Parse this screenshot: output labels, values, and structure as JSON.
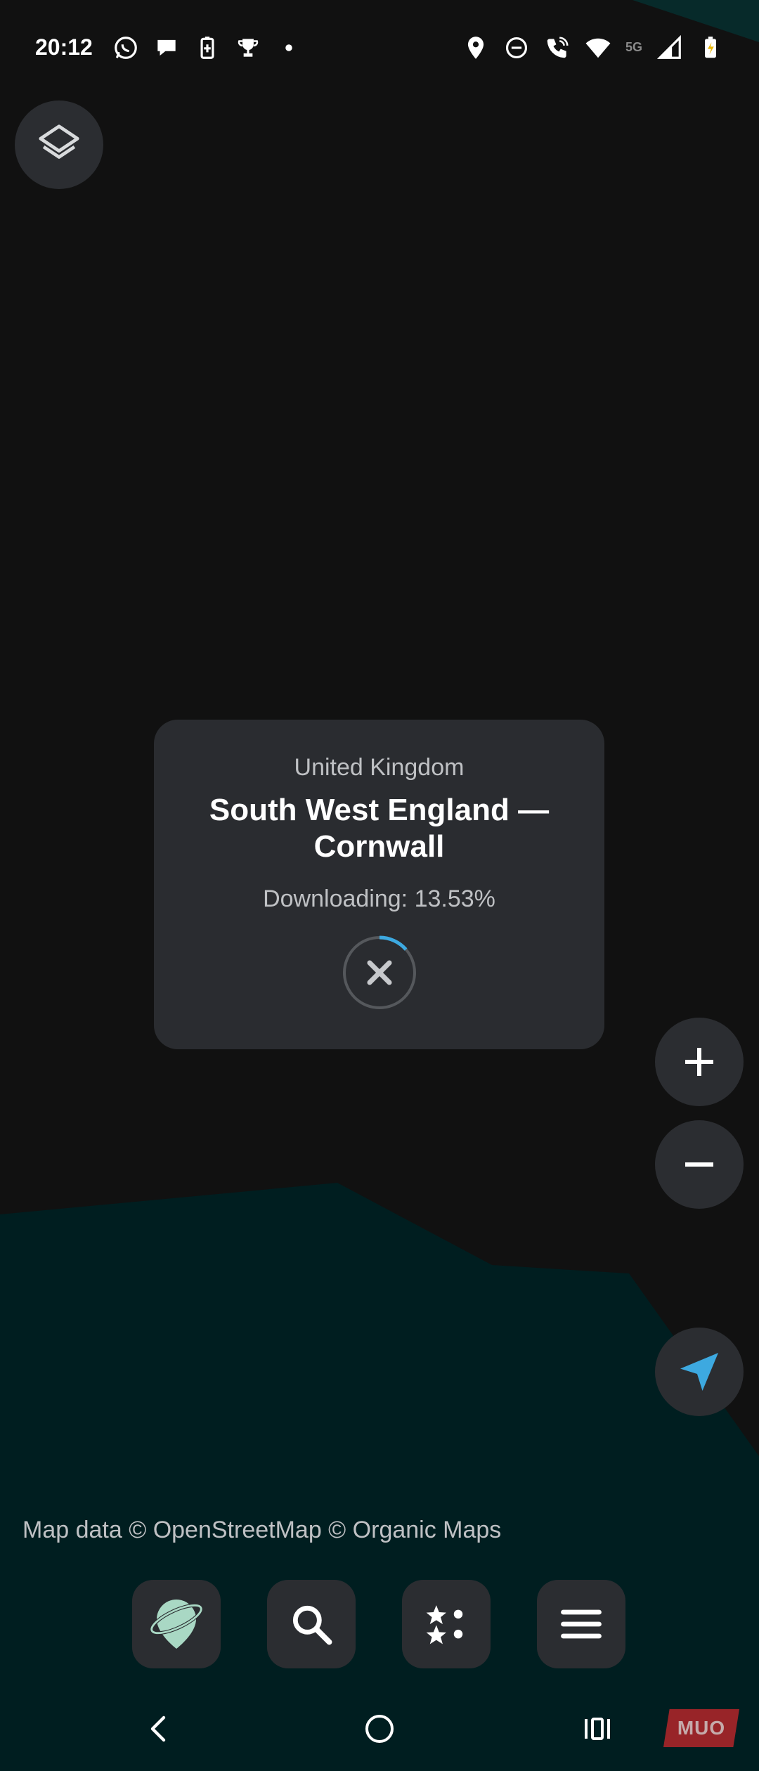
{
  "status_bar": {
    "time": "20:12",
    "left_icons": [
      "whatsapp-icon",
      "chat-bubble-icon",
      "battery-saver-icon",
      "trophy-icon",
      "dot-icon"
    ],
    "right_icons": [
      "location-icon",
      "do-not-disturb-icon",
      "wifi-calling-icon",
      "wifi-icon",
      "cell-signal-icon",
      "battery-charging-icon"
    ],
    "network": "5G"
  },
  "download_card": {
    "country": "United Kingdom",
    "region": "South West England — Cornwall",
    "progress_label": "Downloading: 13.53%",
    "progress_percent": 13.53,
    "cancel_icon": "close-icon"
  },
  "map_controls": {
    "layers_icon": "layers-icon",
    "zoom_in_icon": "plus-icon",
    "zoom_out_icon": "minus-icon",
    "locate_icon": "navigation-arrow-icon"
  },
  "attribution": "Map data © OpenStreetMap © Organic Maps",
  "toolbar": {
    "items": [
      {
        "name": "organic-maps-logo-icon"
      },
      {
        "name": "search-icon"
      },
      {
        "name": "bookmarks-icon"
      },
      {
        "name": "menu-icon"
      }
    ]
  },
  "navbar": {
    "items": [
      "back-icon",
      "home-icon",
      "recent-apps-icon"
    ]
  },
  "watermark": "MUO",
  "colors": {
    "background": "#111111",
    "land_teal": "#001e20",
    "button_bg": "#2b2d31",
    "card_bg": "#2a2c30",
    "accent_blue": "#3da9e0"
  }
}
